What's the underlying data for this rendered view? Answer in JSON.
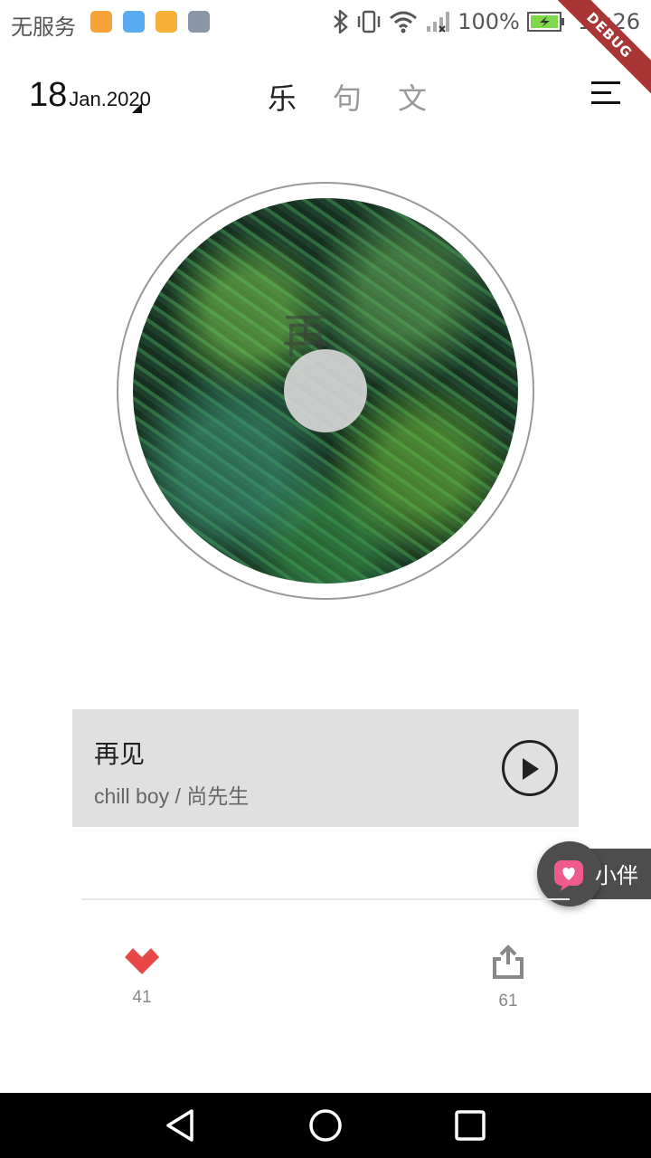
{
  "status_bar": {
    "carrier": "无服务",
    "battery": "100%",
    "time": "16:26",
    "debug_label": "DEBUG"
  },
  "header": {
    "date_day": "18",
    "date_month_year": "Jan.2020",
    "tabs": [
      {
        "label": "乐",
        "active": true
      },
      {
        "label": "句",
        "active": false
      },
      {
        "label": "文",
        "active": false
      }
    ]
  },
  "cover": {
    "glyph": "再"
  },
  "song": {
    "title": "再见",
    "artist": "chill boy / 尚先生"
  },
  "companion": {
    "label": "小伴"
  },
  "actions": {
    "like_count": "41",
    "share_count": "61"
  },
  "colors": {
    "accent_heart": "#e84848",
    "companion_pink": "#f05a8c",
    "card_bg": "#e0e0e0"
  }
}
